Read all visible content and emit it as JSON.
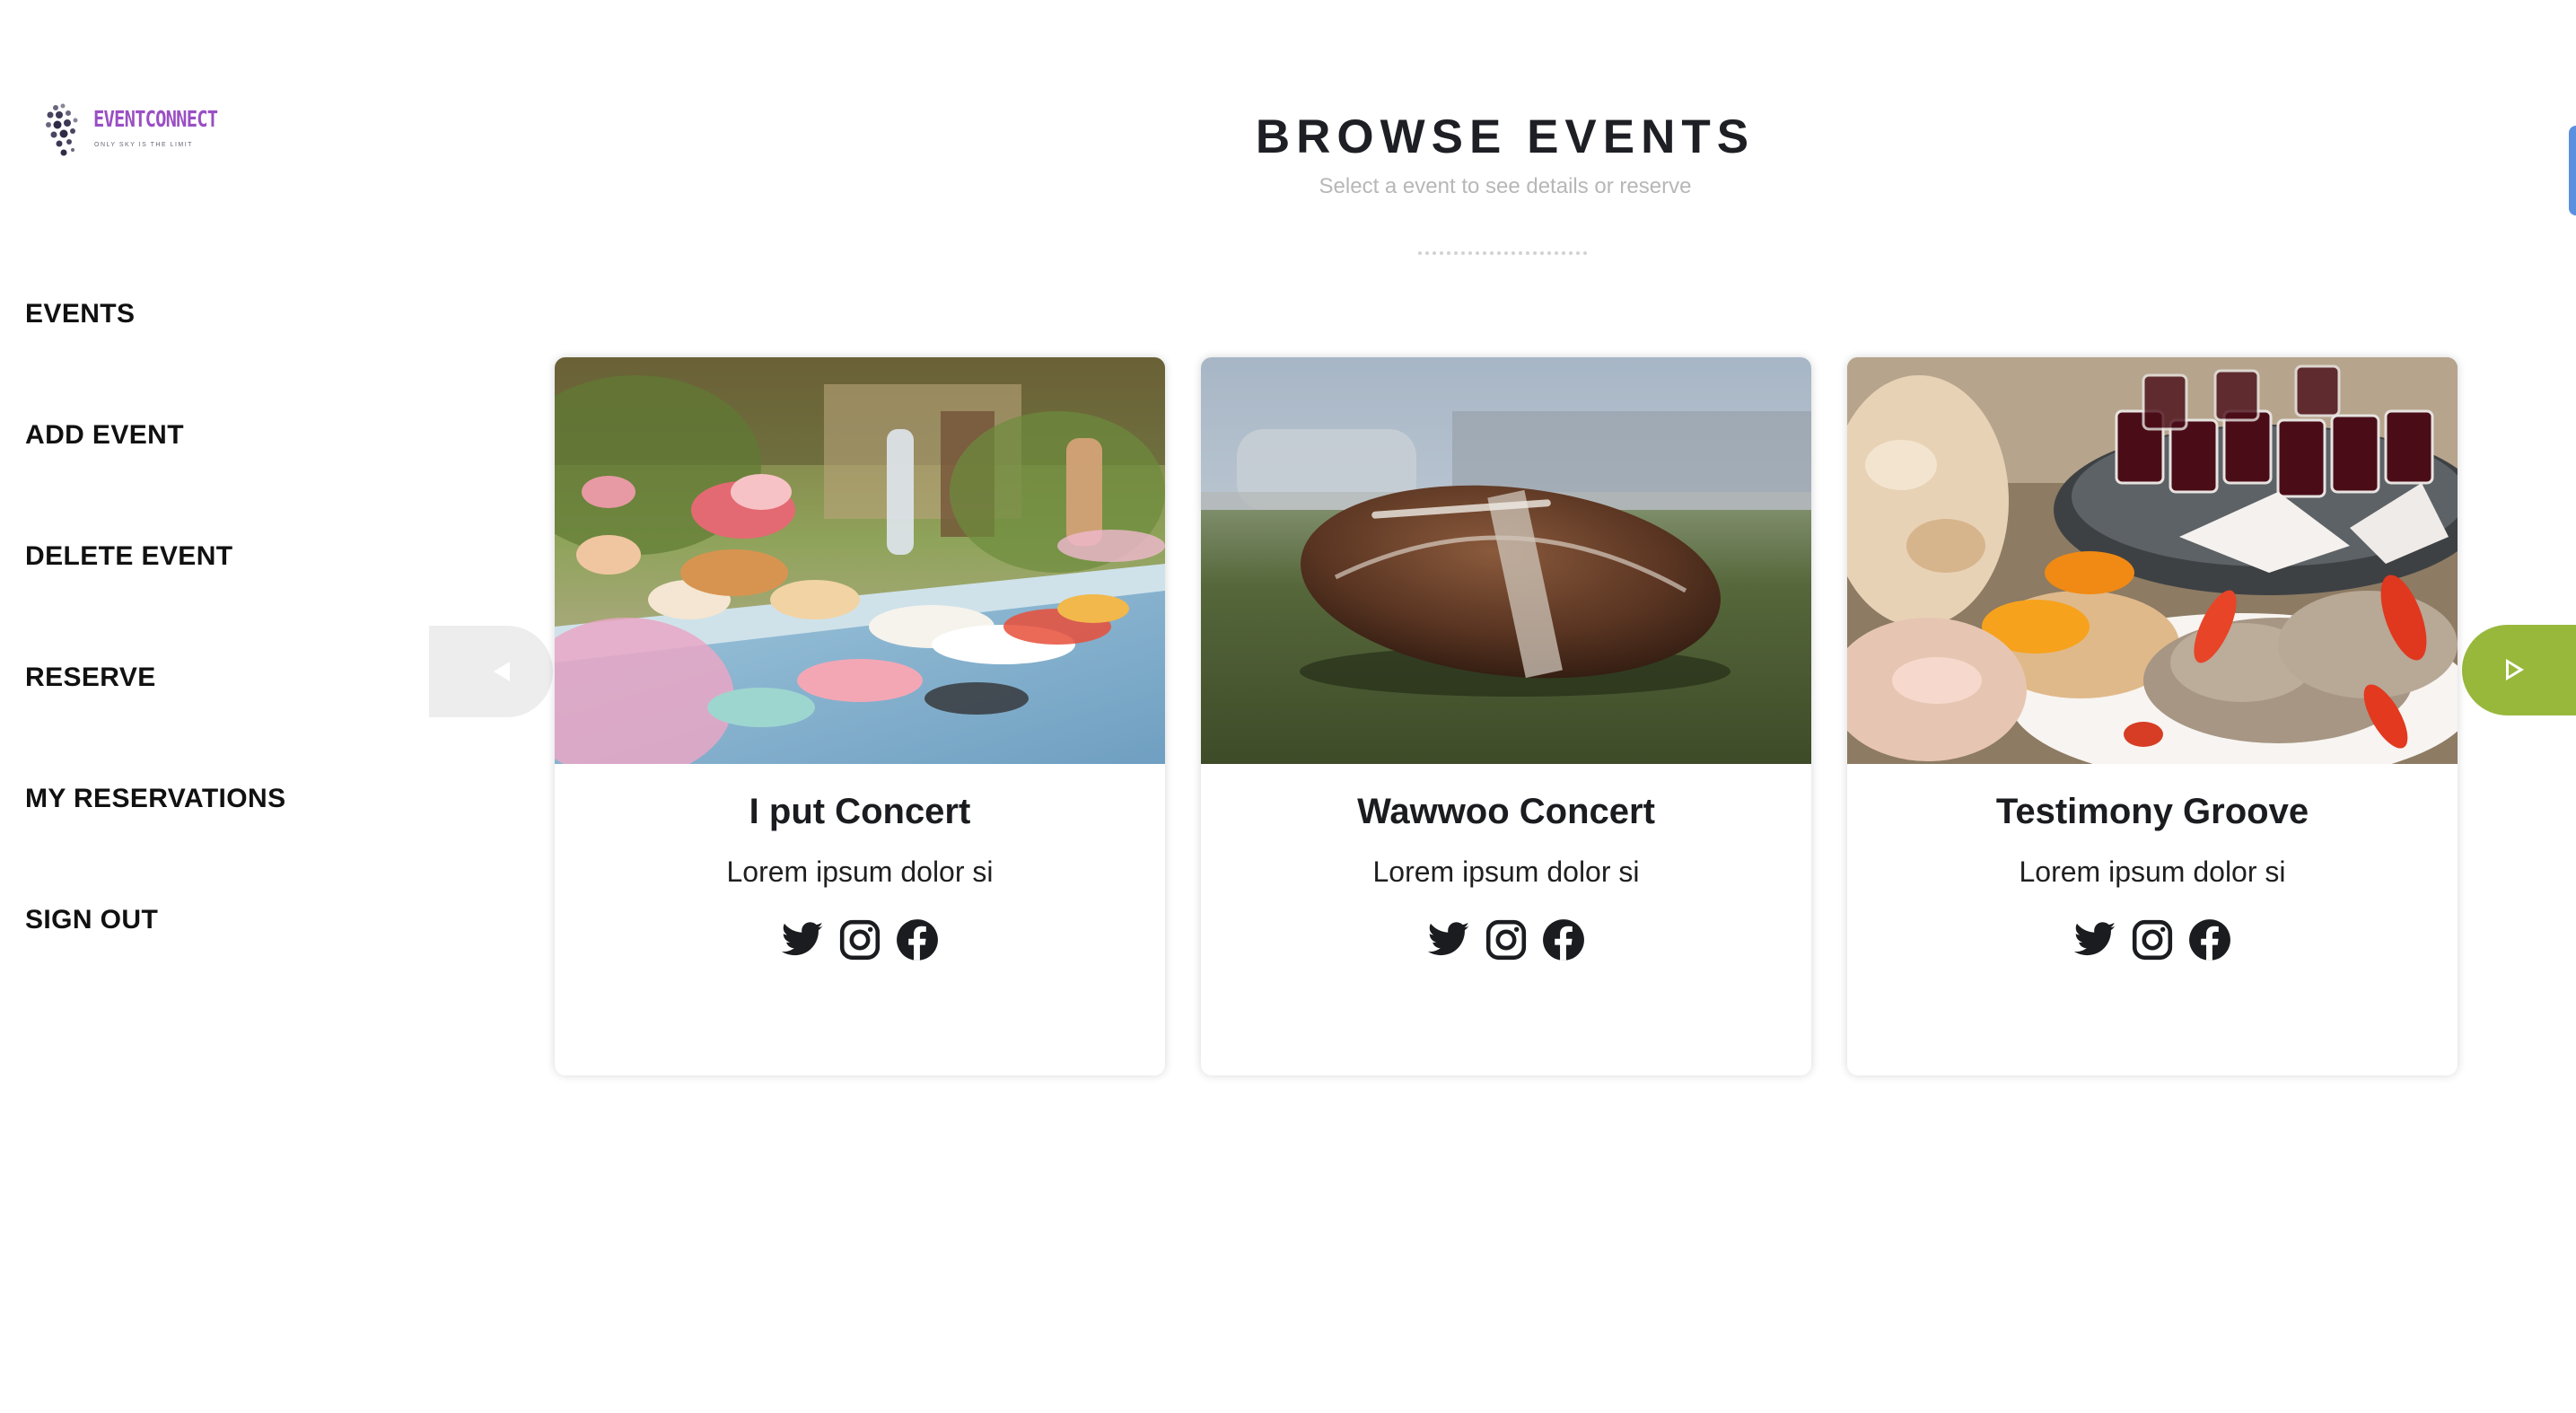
{
  "brand": {
    "name": "EVENTCONNECT",
    "tagline": "ONLY SKY IS THE LIMIT",
    "color": "#9a4fc4"
  },
  "sidebar": {
    "items": [
      {
        "label": "EVENTS"
      },
      {
        "label": "ADD EVENT"
      },
      {
        "label": "DELETE EVENT"
      },
      {
        "label": "RESERVE"
      },
      {
        "label": "MY RESERVATIONS"
      },
      {
        "label": "SIGN OUT"
      }
    ]
  },
  "header": {
    "title": "BROWSE EVENTS",
    "subtitle": "Select a event to see details or reserve"
  },
  "carousel": {
    "prev_icon": "caret-left-icon",
    "next_icon": "caret-right-icon",
    "next_color": "#98b83c",
    "cards": [
      {
        "title": "I put Concert",
        "description": "Lorem ipsum dolor si",
        "image": "dessert-table-photo"
      },
      {
        "title": "Wawwoo Concert",
        "description": "Lorem ipsum dolor si",
        "image": "football-photo"
      },
      {
        "title": "Testimony Groove",
        "description": "Lorem ipsum dolor si",
        "image": "food-wine-photo"
      }
    ],
    "social_icons": [
      "twitter-icon",
      "instagram-icon",
      "facebook-icon"
    ]
  }
}
